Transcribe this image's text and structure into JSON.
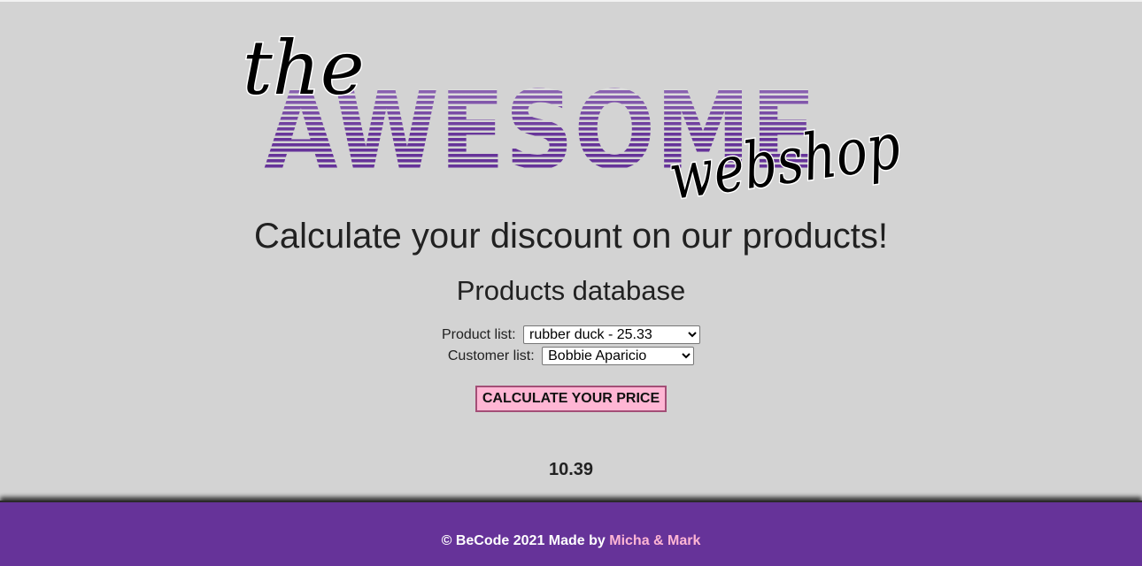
{
  "logo": {
    "word_the": "the",
    "word_awesome": "AWESOME",
    "word_webshop": "webshop",
    "colors": {
      "awesome_stripes": "#663399",
      "awesome_highlight": "#8f6bc2",
      "script": "#000000"
    }
  },
  "headline": "Calculate your discount on our products!",
  "subheadline": "Products database",
  "form": {
    "product_label": "Product list:",
    "product_selected": "rubber duck - 25.33",
    "customer_label": "Customer list:",
    "customer_selected": "Bobbie Aparicio",
    "calculate_button": "CALCULATE YOUR PRICE"
  },
  "result": "10.39",
  "footer": {
    "text": "© BeCode 2021 Made by",
    "link": "Micha & Mark",
    "colors": {
      "background": "#663399",
      "link": "#ffb6d4"
    }
  }
}
